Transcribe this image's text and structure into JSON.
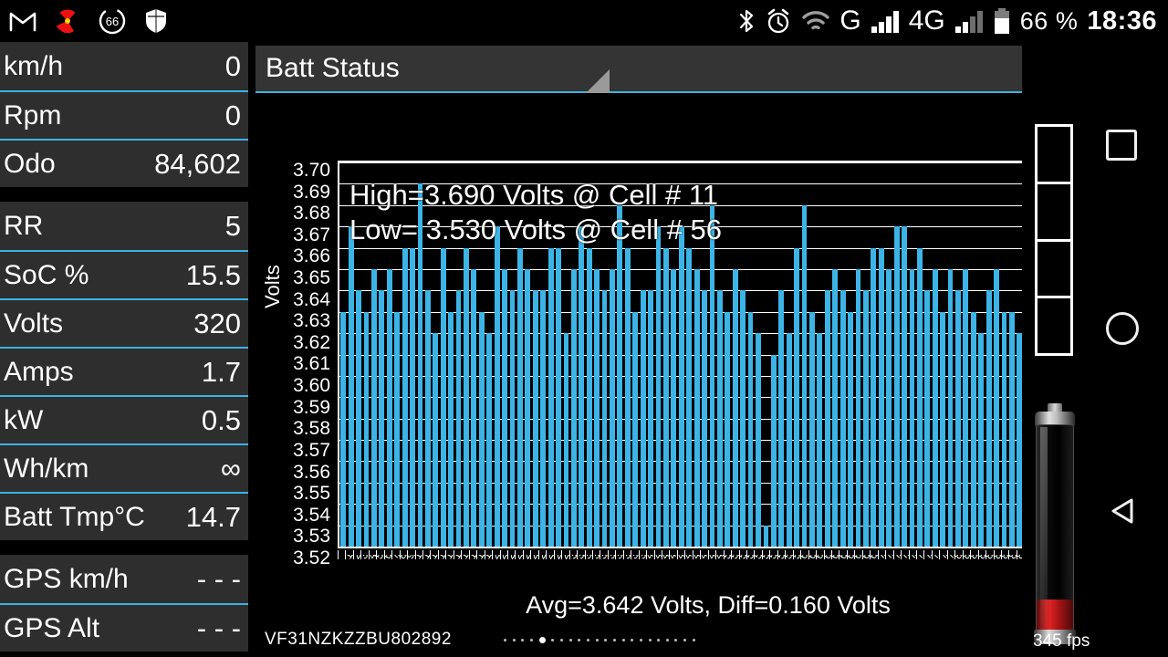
{
  "statusbar": {
    "icons_left": [
      "gmail-icon",
      "radiation-icon",
      "battery-circle-66-icon",
      "shield-icon"
    ],
    "battery_circle_label": "66",
    "icons_right": [
      "bluetooth-icon",
      "alarm-icon",
      "wifi-icon"
    ],
    "network_g": "G",
    "network_4g": "4G",
    "battery_percent": "66 %",
    "clock": "18:36"
  },
  "sidebar": {
    "groups": [
      {
        "rows": [
          {
            "label": "km/h",
            "value": "0"
          },
          {
            "label": "Rpm",
            "value": "0"
          },
          {
            "label": "Odo",
            "value": "84,602"
          }
        ]
      },
      {
        "rows": [
          {
            "label": "RR",
            "value": "5"
          },
          {
            "label": "SoC %",
            "value": "15.5"
          },
          {
            "label": "Volts",
            "value": "320"
          },
          {
            "label": "Amps",
            "value": "1.7"
          },
          {
            "label": "kW",
            "value": "0.5"
          },
          {
            "label": "Wh/km",
            "value": "∞"
          },
          {
            "label": "Batt Tmp°C",
            "value": "14.7"
          }
        ]
      },
      {
        "rows": [
          {
            "label": "GPS km/h",
            "value": "- - -"
          },
          {
            "label": "GPS Alt",
            "value": "- - -"
          }
        ]
      }
    ]
  },
  "panel": {
    "title": "Batt Status",
    "resize_handle": "resize-handle-icon"
  },
  "footer": {
    "vin": "VF31NZKZZBU802892",
    "page_dots_count": 22,
    "page_dots_active_index": 4,
    "fps": "345 fps"
  },
  "rail": {
    "segment_gauge_segments": 4,
    "segment_gauge_filled": 0,
    "battery_fill_percent": 15.5,
    "nav": [
      {
        "name": "recents-button",
        "icon": "square-icon"
      },
      {
        "name": "home-button",
        "icon": "circle-icon"
      },
      {
        "name": "back-button",
        "icon": "triangle-left-icon"
      }
    ]
  },
  "colors": {
    "accent": "#3bb3e3",
    "bar": "#3db4e6",
    "panel_bg": "#2e2e2e",
    "header_bg": "#343434",
    "battery_fill": "#e02424",
    "background": "#000000",
    "text": "#ffffff"
  },
  "chart_data": {
    "type": "bar",
    "title": "Batt Status",
    "xlabel": "",
    "ylabel": "Volts",
    "ylim": [
      3.52,
      3.7
    ],
    "ytick_step": 0.01,
    "yticks": [
      "3.70",
      "3.69",
      "3.68",
      "3.67",
      "3.66",
      "3.65",
      "3.64",
      "3.63",
      "3.62",
      "3.61",
      "3.60",
      "3.59",
      "3.58",
      "3.57",
      "3.56",
      "3.55",
      "3.54",
      "3.53",
      "3.52"
    ],
    "grid": true,
    "legend": "none",
    "annotations": [
      "High=3.690 Volts @ Cell # 11",
      "Low= 3.530 Volts @ Cell # 56"
    ],
    "summary": "Avg=3.642 Volts, Diff=0.160 Volts",
    "stats": {
      "high_volts": 3.69,
      "high_cell": 11,
      "low_volts": 3.53,
      "low_cell": 56,
      "avg_volts": 3.642,
      "diff_volts": 0.16
    },
    "categories": [
      1,
      2,
      3,
      4,
      5,
      6,
      7,
      8,
      9,
      10,
      11,
      12,
      13,
      14,
      15,
      16,
      17,
      18,
      19,
      20,
      21,
      22,
      23,
      24,
      25,
      26,
      27,
      28,
      29,
      30,
      31,
      32,
      33,
      34,
      35,
      36,
      37,
      38,
      39,
      40,
      41,
      42,
      43,
      44,
      45,
      46,
      47,
      48,
      49,
      50,
      51,
      52,
      53,
      54,
      55,
      56,
      57,
      58,
      59,
      60,
      61,
      62,
      63,
      64,
      65,
      66,
      67,
      68,
      69,
      70,
      71,
      72,
      73,
      74,
      75,
      76,
      77,
      78,
      79,
      80,
      81,
      82,
      83,
      84,
      85,
      86,
      87,
      88,
      89,
      90,
      91,
      92,
      93,
      94,
      95,
      96
    ],
    "values": [
      3.63,
      3.67,
      3.64,
      3.63,
      3.65,
      3.64,
      3.65,
      3.63,
      3.66,
      3.66,
      3.69,
      3.64,
      3.62,
      3.66,
      3.63,
      3.64,
      3.66,
      3.65,
      3.63,
      3.62,
      3.67,
      3.65,
      3.64,
      3.66,
      3.65,
      3.64,
      3.64,
      3.66,
      3.66,
      3.62,
      3.65,
      3.67,
      3.66,
      3.65,
      3.64,
      3.65,
      3.68,
      3.66,
      3.63,
      3.64,
      3.64,
      3.67,
      3.66,
      3.65,
      3.67,
      3.66,
      3.65,
      3.64,
      3.68,
      3.64,
      3.63,
      3.65,
      3.64,
      3.63,
      3.62,
      3.53,
      3.61,
      3.64,
      3.62,
      3.66,
      3.68,
      3.63,
      3.62,
      3.64,
      3.65,
      3.64,
      3.63,
      3.65,
      3.64,
      3.66,
      3.66,
      3.65,
      3.67,
      3.67,
      3.65,
      3.66,
      3.64,
      3.65,
      3.63,
      3.65,
      3.64,
      3.65,
      3.63,
      3.62,
      3.64,
      3.65,
      3.63,
      3.63,
      3.62,
      3.68,
      3.62,
      3.62,
      3.67,
      3.64,
      3.63,
      3.61
    ]
  }
}
